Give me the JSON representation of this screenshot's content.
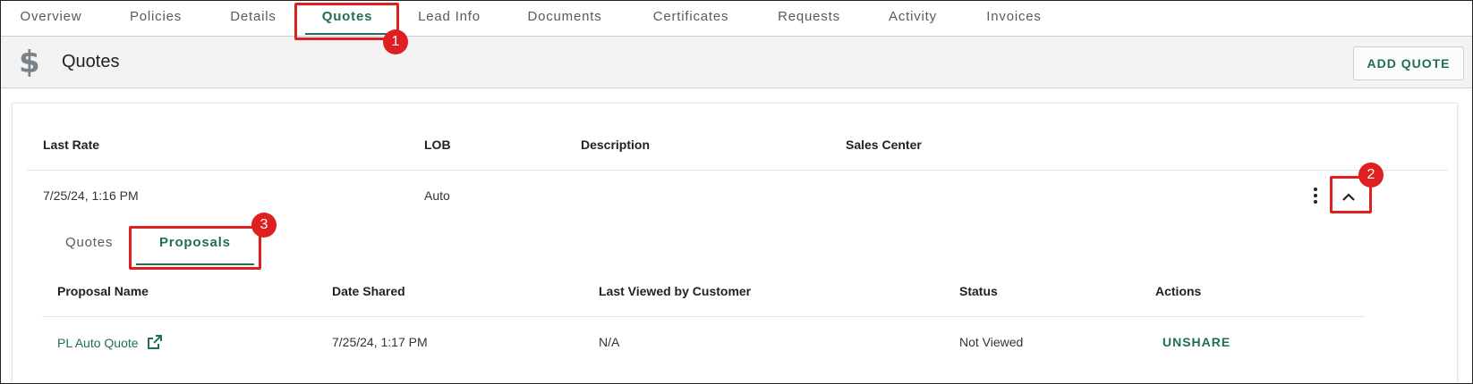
{
  "top_nav": {
    "tabs": [
      {
        "label": "Overview"
      },
      {
        "label": "Policies"
      },
      {
        "label": "Details"
      },
      {
        "label": "Quotes"
      },
      {
        "label": "Lead Info"
      },
      {
        "label": "Documents"
      },
      {
        "label": "Certificates"
      },
      {
        "label": "Requests"
      },
      {
        "label": "Activity"
      },
      {
        "label": "Invoices"
      }
    ],
    "active": "Quotes"
  },
  "header": {
    "icon": "dollar-icon",
    "icon_glyph": "$",
    "title": "Quotes",
    "add_button": "ADD QUOTE"
  },
  "quotes_table": {
    "columns": [
      "Last Rate",
      "LOB",
      "Description",
      "Sales Center"
    ],
    "rows": [
      {
        "last_rate": "7/25/24, 1:16 PM",
        "lob": "Auto",
        "description": "",
        "sales_center": ""
      }
    ]
  },
  "sub_tabs": {
    "tabs": [
      {
        "label": "Quotes"
      },
      {
        "label": "Proposals"
      }
    ],
    "active": "Proposals"
  },
  "proposals_table": {
    "columns": [
      "Proposal Name",
      "Date Shared",
      "Last Viewed by Customer",
      "Status",
      "Actions"
    ],
    "rows": [
      {
        "name": "PL Auto Quote",
        "date_shared": "7/25/24, 1:17 PM",
        "last_viewed": "N/A",
        "status": "Not Viewed",
        "action": "UNSHARE"
      }
    ]
  },
  "annotations": [
    {
      "label": "1"
    },
    {
      "label": "2"
    },
    {
      "label": "3"
    }
  ],
  "colors": {
    "accent": "#1f6e5a",
    "annotation": "#e02020",
    "header_bg": "#f3f3f3"
  }
}
